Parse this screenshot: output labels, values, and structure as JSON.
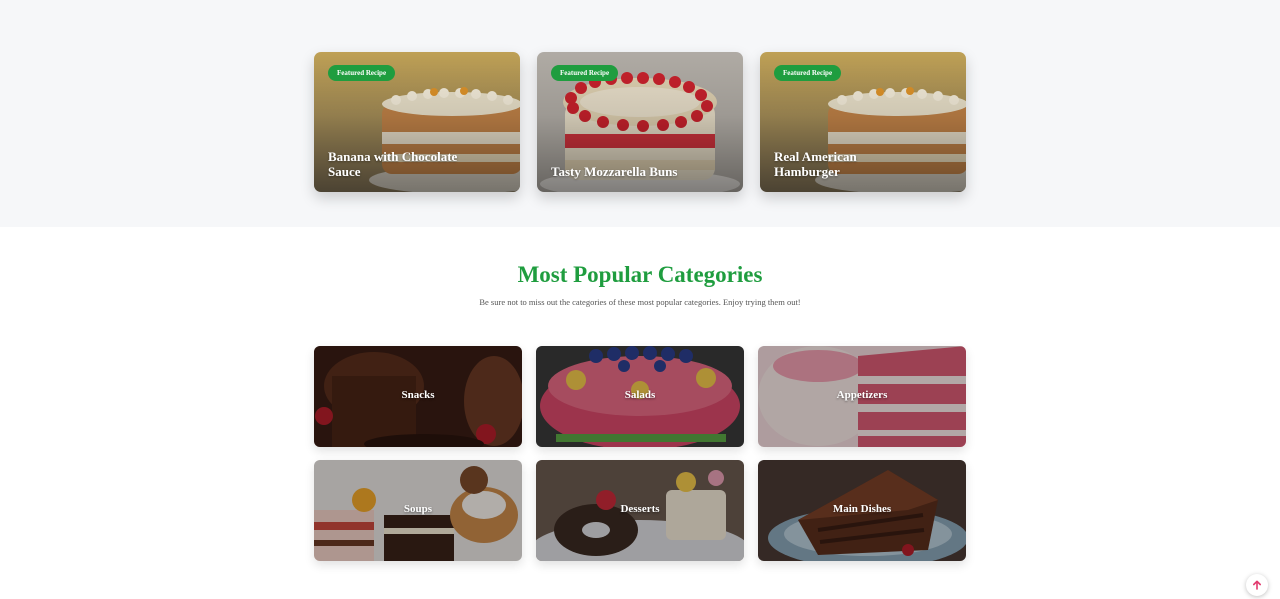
{
  "featured": {
    "cards": [
      {
        "badge": "Featured Recipe",
        "title": "Banana with Chocolate Sauce",
        "image": "layer-cake-icon"
      },
      {
        "badge": "Featured Recipe",
        "title": "Tasty Mozzarella Buns",
        "image": "strawberry-cake-icon"
      },
      {
        "badge": "Featured Recipe",
        "title": "Real American Hamburger",
        "image": "layer-cake-icon"
      }
    ]
  },
  "categories_section": {
    "title": "Most Popular Categories",
    "subtitle": "Be sure not to miss out the categories of these most popular categories. Enjoy trying them out!",
    "items": [
      {
        "label": "Snacks"
      },
      {
        "label": "Salads"
      },
      {
        "label": "Appetizers"
      },
      {
        "label": "Soups"
      },
      {
        "label": "Desserts"
      },
      {
        "label": "Main Dishes"
      }
    ]
  },
  "colors": {
    "accent_green": "#1f9d3f",
    "top_band_bg": "#f6f7f9",
    "scroll_arrow": "#e23a6e"
  }
}
